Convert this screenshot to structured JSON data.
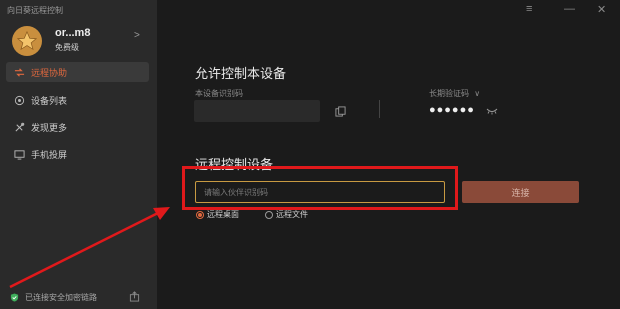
{
  "app": {
    "title": "向日葵远程控制"
  },
  "user": {
    "name": "or...m8",
    "level": "免费级",
    "chevron": ">"
  },
  "nav": {
    "items": [
      {
        "label": "远程协助",
        "icon": "remote-assist-icon",
        "active": true
      },
      {
        "label": "设备列表",
        "icon": "device-list-icon",
        "active": false
      },
      {
        "label": "发现更多",
        "icon": "discover-icon",
        "active": false
      },
      {
        "label": "手机投屏",
        "icon": "screen-cast-icon",
        "active": false
      }
    ]
  },
  "status": {
    "security": "已连接安全加密链路"
  },
  "window": {
    "menu": "≡",
    "minimize": "—",
    "close": "✕"
  },
  "allow": {
    "title": "允许控制本设备",
    "device_id_label": "本设备识别码",
    "password_label": "长期验证码",
    "password_chevron": "∨",
    "password_masked": "●●●●●●"
  },
  "remote": {
    "title": "远程控制设备",
    "input_placeholder": "请输入伙伴识别码",
    "connect_label": "连接",
    "mode_desktop": "远程桌面",
    "mode_file": "远程文件"
  },
  "colors": {
    "accent": "#e0683e",
    "highlight_box": "#e0191b",
    "input_border": "#c89a42",
    "connect_button": "#8a4a39"
  }
}
